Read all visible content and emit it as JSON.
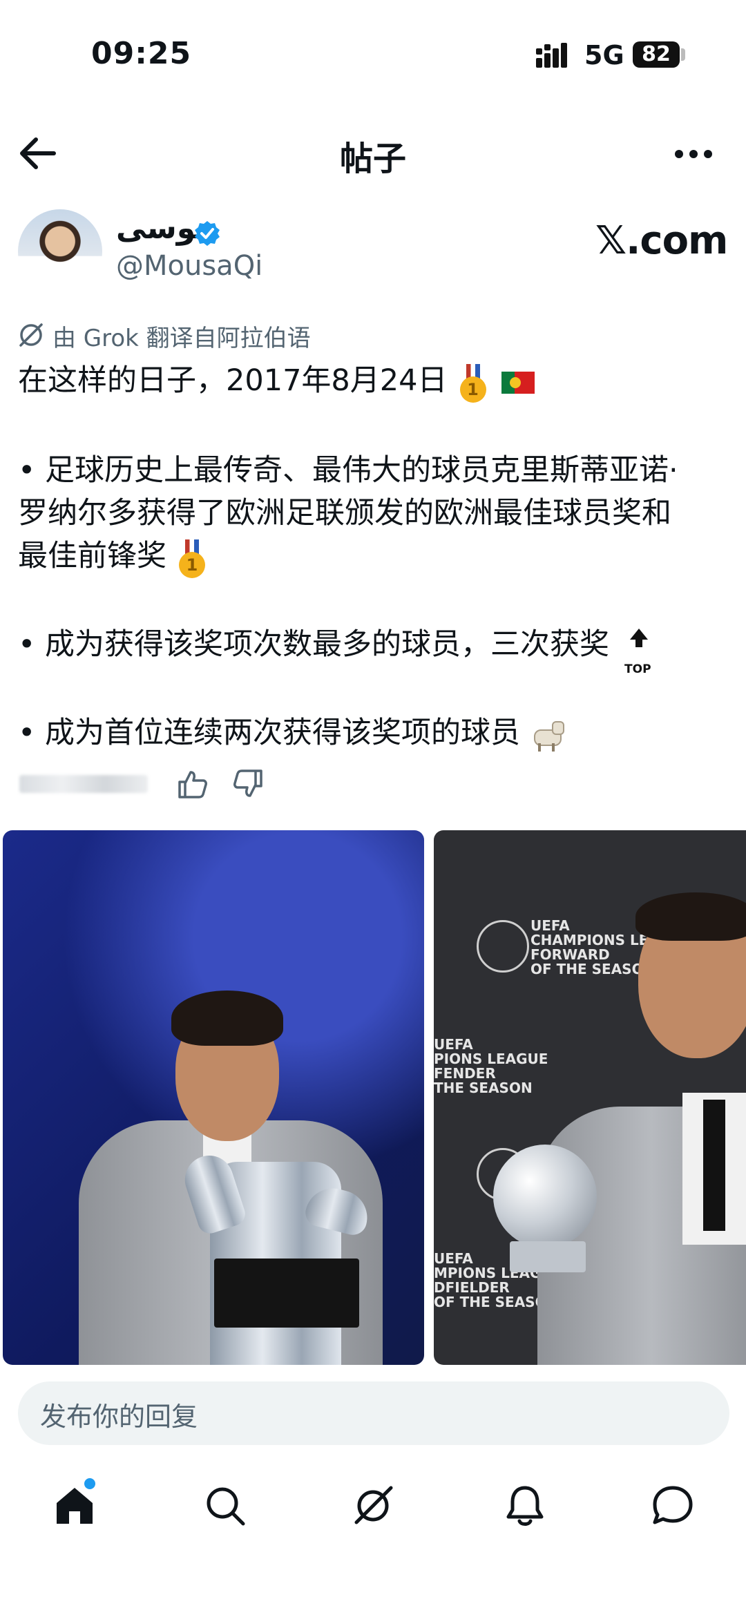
{
  "status_bar": {
    "time": "09:25",
    "network": "5G",
    "battery": "82"
  },
  "header": {
    "title": "帖子"
  },
  "post": {
    "author": {
      "display_name": "موسى",
      "handle": "@MousaQi"
    },
    "site_logo": "𝕏.com",
    "translation_note": "由 Grok 翻译自阿拉伯语",
    "lines": [
      "在这样的日子，2017年8月24日",
      "• 足球历史上最传奇、最伟大的球员克里斯蒂亚诺·",
      "罗纳尔多获得了欧洲足联颁发的欧洲最佳球员奖和",
      "最佳前锋奖",
      "• 成为获得该奖项次数最多的球员，三次获奖",
      "• 成为首位连续两次获得该奖项的球员"
    ],
    "emoji": {
      "medal_number": "1",
      "top_badge": "TOP"
    },
    "photo_texts": {
      "photo_2_logo_1": "UEFA\nCHAMPIONS LEAGUE\nFORWARD\nOF THE SEASON",
      "photo_2_logo_2": "UEFA\nPIONS LEAGUE\nFENDER\nTHE SEASON",
      "photo_2_logo_3": "UEFA\nMPIONS LEAGUE\nDFIELDER\nOF THE SEASON"
    }
  },
  "reply": {
    "placeholder": "发布你的回复"
  },
  "colors": {
    "accent": "#1d9bf0",
    "text": "#0f1419",
    "muted": "#536471",
    "reply_bg": "#eff3f4"
  },
  "icons": [
    "back-arrow-icon",
    "more-icon",
    "verified-icon",
    "translate-icon",
    "thumbs-up-icon",
    "thumbs-down-icon",
    "home-icon",
    "search-icon",
    "grok-icon",
    "bell-icon",
    "message-icon"
  ]
}
